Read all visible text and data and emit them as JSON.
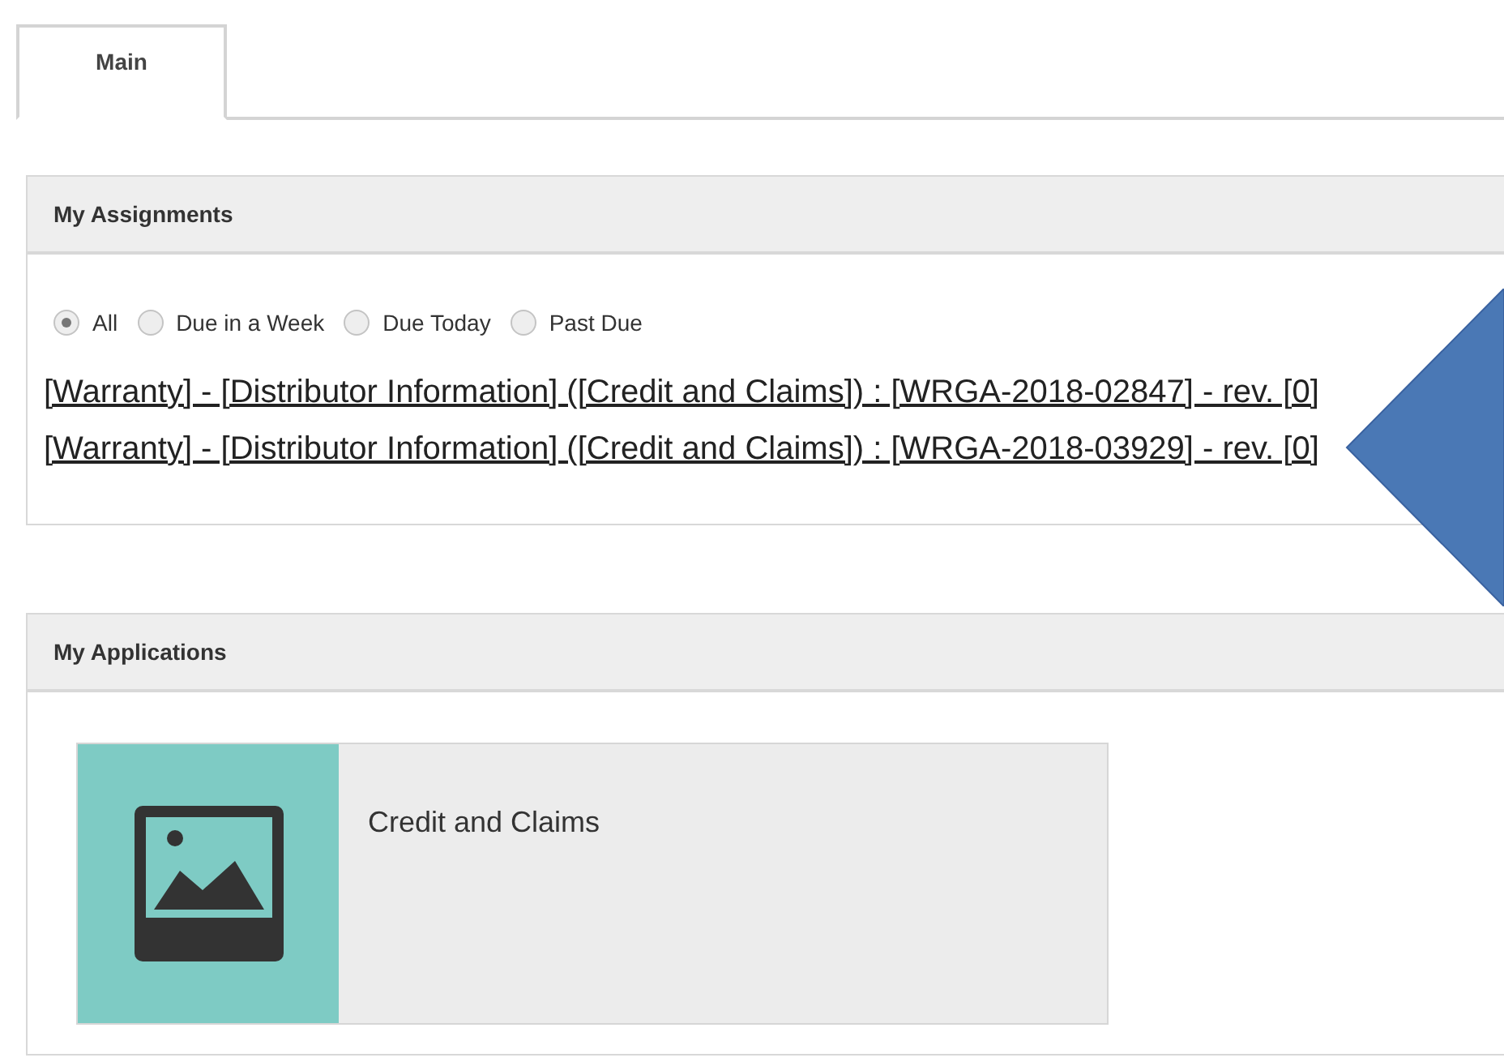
{
  "tabs": [
    {
      "label": "Main",
      "selected": true
    }
  ],
  "assignments": {
    "title": "My Assignments",
    "filters": [
      {
        "label": "All",
        "selected": true
      },
      {
        "label": "Due in a Week",
        "selected": false
      },
      {
        "label": "Due Today",
        "selected": false
      },
      {
        "label": "Past Due",
        "selected": false
      }
    ],
    "links": [
      "[Warranty] - [Distributor Information] ([Credit and Claims]) : [WRGA-2018-02847] - rev. [0]",
      "[Warranty] - [Distributor Information] ([Credit and Claims]) : [WRGA-2018-03929] - rev. [0]"
    ]
  },
  "applications": {
    "title": "My Applications",
    "tiles": [
      {
        "label": "Credit and Claims"
      }
    ]
  }
}
